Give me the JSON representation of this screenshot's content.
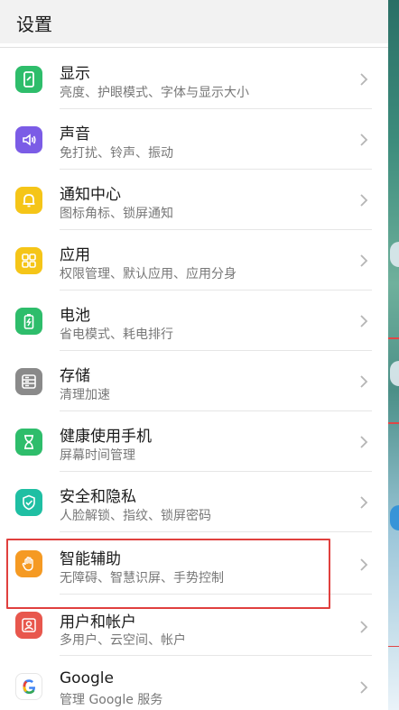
{
  "header": {
    "title": "设置"
  },
  "rows": [
    {
      "title": "显示",
      "subtitle": "亮度、护眼模式、字体与显示大小",
      "icon": "display-icon",
      "color": "#2ebd6b"
    },
    {
      "title": "声音",
      "subtitle": "免打扰、铃声、振动",
      "icon": "sound-icon",
      "color": "#7b5ce6"
    },
    {
      "title": "通知中心",
      "subtitle": "图标角标、锁屏通知",
      "icon": "notification-bell-icon",
      "color": "#f5c518"
    },
    {
      "title": "应用",
      "subtitle": "权限管理、默认应用、应用分身",
      "icon": "apps-grid-icon",
      "color": "#f5c518"
    },
    {
      "title": "电池",
      "subtitle": "省电模式、耗电排行",
      "icon": "battery-icon",
      "color": "#2ebd6b"
    },
    {
      "title": "存储",
      "subtitle": "清理加速",
      "icon": "storage-icon",
      "color": "#8a8a8a"
    },
    {
      "title": "健康使用手机",
      "subtitle": "屏幕时间管理",
      "icon": "hourglass-icon",
      "color": "#2ebd6b"
    },
    {
      "title": "安全和隐私",
      "subtitle": "人脸解锁、指纹、锁屏密码",
      "icon": "shield-check-icon",
      "color": "#1fbfa3"
    },
    {
      "title": "智能辅助",
      "subtitle": "无障碍、智慧识屏、手势控制",
      "icon": "hand-icon",
      "color": "#f59a23"
    },
    {
      "title": "用户和帐户",
      "subtitle": "多用户、云空间、帐户",
      "icon": "user-icon",
      "color": "#e8574d"
    },
    {
      "title": "Google",
      "subtitle": "管理 Google 服务",
      "icon": "google-icon",
      "color": "#ffffff"
    }
  ]
}
